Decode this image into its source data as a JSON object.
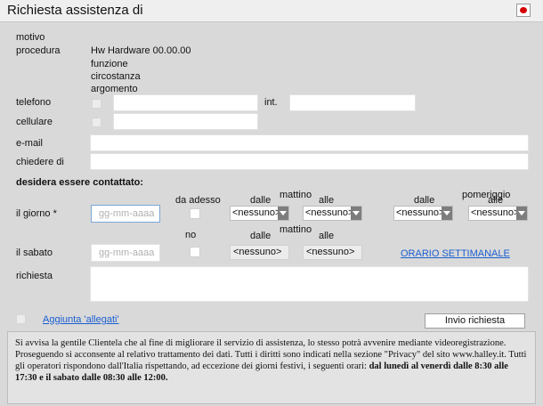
{
  "window": {
    "title": "Richiesta assistenza di"
  },
  "form": {
    "motivo_label": "motivo",
    "procedura_label": "procedura",
    "procedura_value": "Hw Hardware 00.00.00",
    "funzione_label": "funzione",
    "circostanza_label": "circostanza",
    "argomento_label": "argomento",
    "telefono_label": "telefono",
    "int_label": "int.",
    "cellulare_label": "cellulare",
    "email_label": "e-mail",
    "chiedere_label": "chiedere di",
    "contattato_heading": "desidera essere contattato:",
    "da_adesso_label": "da adesso",
    "no_label": "no",
    "dalle_label": "dalle",
    "alle_label": "alle",
    "mattino_label": "mattino",
    "pomeriggio_label": "pomeriggio",
    "giorno_label": "il giorno *",
    "sabato_label": "il sabato",
    "date_placeholder": "gg-mm-aaaa",
    "select_none": "<nessuno>",
    "orario_link": "ORARIO SETTIMANALE",
    "richiesta_label": "richiesta",
    "allegati_link": "Aggiunta 'allegati'",
    "invio_button": "Invio richiesta"
  },
  "notice": {
    "text": "Si avvisa la gentile Clientela che al fine di migliorare il servizio di assistenza, lo stesso potrà avvenire mediante videoregistrazione. Proseguendo si acconsente al relativo trattamento dei dati. Tutti i diritti sono indicati nella sezione \"Privacy\" del sito www.halley.it. Tutti gli operatori rispondono dall'Italia rispettando, ad eccezione dei giorni festivi, i seguenti orari: ",
    "hours": "dal lunedì al venerdì dalle 8:30 alle 17:30 e il sabato dalle 08:30 alle 12:00."
  }
}
